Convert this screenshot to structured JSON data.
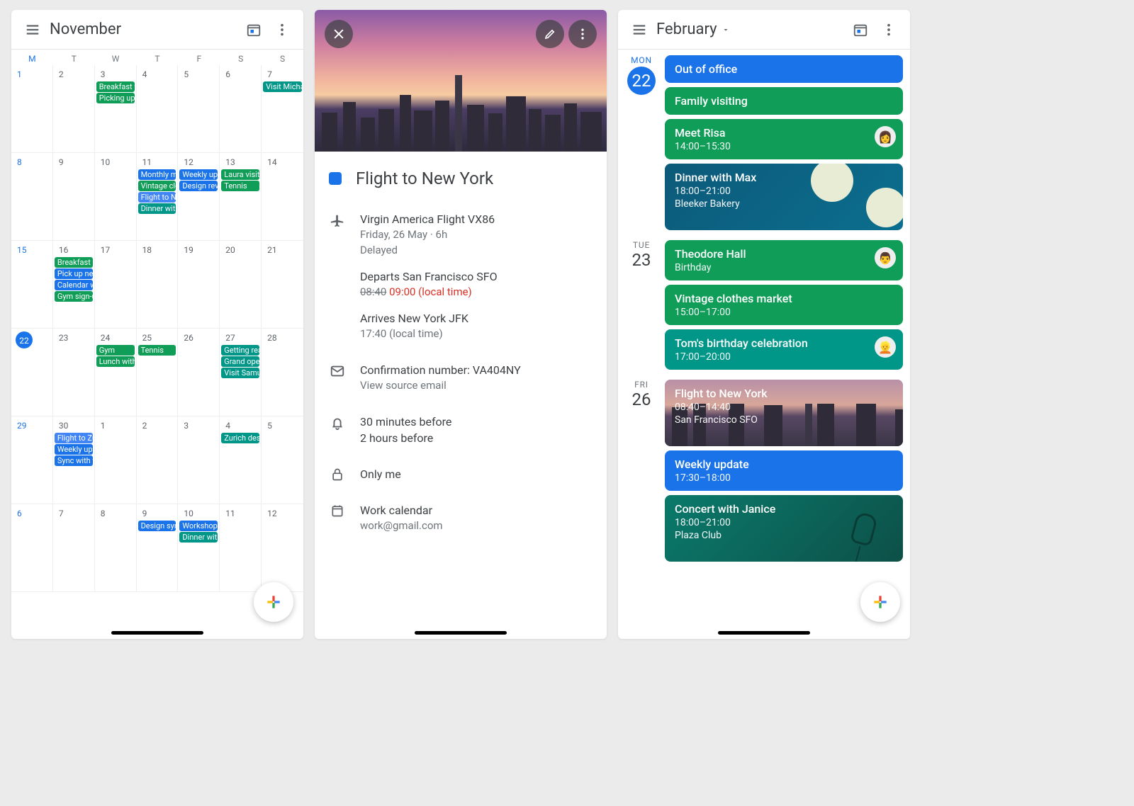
{
  "screen1": {
    "title": "November",
    "dow": [
      "M",
      "T",
      "W",
      "T",
      "F",
      "S",
      "S"
    ],
    "weeks": [
      [
        {
          "n": "1"
        },
        {
          "n": "2"
        },
        {
          "n": "3",
          "e": [
            {
              "t": "Breakfast w",
              "c": "green"
            },
            {
              "t": "Picking up",
              "c": "green"
            }
          ]
        },
        {
          "n": "4"
        },
        {
          "n": "5"
        },
        {
          "n": "6"
        },
        {
          "n": "7",
          "e": [
            {
              "t": "Visit Michae",
              "c": "teal"
            }
          ]
        }
      ],
      [
        {
          "n": "8"
        },
        {
          "n": "9"
        },
        {
          "n": "10"
        },
        {
          "n": "11",
          "e": [
            {
              "t": "Monthly me",
              "c": "blue"
            },
            {
              "t": "Vintage clo",
              "c": "green"
            },
            {
              "t": "Flight to Ne",
              "c": "blue2"
            },
            {
              "t": "Dinner with",
              "c": "teal"
            }
          ]
        },
        {
          "n": "12",
          "e": [
            {
              "t": "Weekly upd",
              "c": "blue"
            },
            {
              "t": "Design revi",
              "c": "blue"
            }
          ]
        },
        {
          "n": "13",
          "e": [
            {
              "t": "Laura visitin",
              "c": "green"
            },
            {
              "t": "Tennis",
              "c": "green"
            }
          ]
        },
        {
          "n": "14"
        }
      ],
      [
        {
          "n": "15"
        },
        {
          "n": "16",
          "e": [
            {
              "t": "Breakfast w",
              "c": "green"
            },
            {
              "t": "Pick up new",
              "c": "blue"
            },
            {
              "t": "Calendar w",
              "c": "blue"
            },
            {
              "t": "Gym sign-u",
              "c": "green"
            }
          ]
        },
        {
          "n": "17"
        },
        {
          "n": "18"
        },
        {
          "n": "19"
        },
        {
          "n": "20"
        },
        {
          "n": "21"
        }
      ],
      [
        {
          "n": "22",
          "today": true
        },
        {
          "n": "23"
        },
        {
          "n": "24",
          "e": [
            {
              "t": "Gym",
              "c": "green"
            },
            {
              "t": "Lunch with",
              "c": "green"
            }
          ]
        },
        {
          "n": "25",
          "e": [
            {
              "t": "Tennis",
              "c": "green"
            }
          ]
        },
        {
          "n": "26"
        },
        {
          "n": "27",
          "e": [
            {
              "t": "Getting rea",
              "c": "teal"
            },
            {
              "t": "Grand open",
              "c": "teal"
            },
            {
              "t": "Visit Samue",
              "c": "teal"
            }
          ]
        },
        {
          "n": "28"
        }
      ],
      [
        {
          "n": "29"
        },
        {
          "n": "30",
          "e": [
            {
              "t": "Flight to Zu",
              "c": "blue2"
            },
            {
              "t": "Weekly upd",
              "c": "blue"
            },
            {
              "t": "Sync with t",
              "c": "blue"
            }
          ]
        },
        {
          "n": "1"
        },
        {
          "n": "2"
        },
        {
          "n": "3"
        },
        {
          "n": "4",
          "e": [
            {
              "t": "Zurich desi",
              "c": "teal"
            }
          ]
        },
        {
          "n": "5"
        }
      ],
      [
        {
          "n": "6"
        },
        {
          "n": "7"
        },
        {
          "n": "8"
        },
        {
          "n": "9",
          "e": [
            {
              "t": "Design syn",
              "c": "blue"
            }
          ]
        },
        {
          "n": "10",
          "e": [
            {
              "t": "Workshop",
              "c": "blue"
            },
            {
              "t": "Dinner with",
              "c": "teal"
            }
          ]
        },
        {
          "n": "11"
        },
        {
          "n": "12"
        }
      ]
    ]
  },
  "screen2": {
    "title": "Flight to New York",
    "flight_line": "Virgin America Flight VX86",
    "date_line": "Friday, 26 May  ·  6h",
    "status": "Delayed",
    "dep_label": "Departs San Francisco SFO",
    "dep_old": "08:40",
    "dep_new": "09:00 (local time)",
    "arr_label": "Arrives New York JFK",
    "arr_time": "17:40 (local time)",
    "conf_label": "Confirmation number: VA404NY",
    "conf_link": "View source email",
    "rem1": "30 minutes before",
    "rem2": "2 hours before",
    "vis": "Only me",
    "cal_name": "Work calendar",
    "cal_email": "work@gmail.com"
  },
  "screen3": {
    "title": "February",
    "days": [
      {
        "dow": "MON",
        "num": "22",
        "today": true,
        "cards": [
          {
            "style": "c-blue",
            "title": "Out of office"
          },
          {
            "style": "c-green",
            "title": "Family visiting"
          },
          {
            "style": "c-green",
            "title": "Meet Risa",
            "sub": "14:00–15:30",
            "avatar": "👩",
            "now": true
          },
          {
            "style": "c-dinner",
            "title": "Dinner with Max",
            "sub": "18:00–21:00",
            "sub2": "Bleeker Bakery",
            "deco": "dinner"
          }
        ]
      },
      {
        "dow": "TUE",
        "num": "23",
        "cards": [
          {
            "style": "c-green",
            "title": "Theodore Hall",
            "sub": "Birthday",
            "avatar": "👨"
          },
          {
            "style": "c-green",
            "title": "Vintage clothes market",
            "sub": "15:00–17:00"
          },
          {
            "style": "c-teal",
            "title": "Tom's birthday celebration",
            "sub": "17:00–20:00",
            "avatar": "👱"
          }
        ]
      },
      {
        "dow": "FRI",
        "num": "26",
        "cards": [
          {
            "style": "c-flight",
            "title": "Flight to New York",
            "sub": "08:40–14:40",
            "sub2": "San Francisco SFO",
            "deco": "flight"
          },
          {
            "style": "c-blue",
            "title": "Weekly update",
            "sub": "17:30–18:00"
          },
          {
            "style": "c-concert",
            "title": "Concert with Janice",
            "sub": "18:00–21:00",
            "sub2": "Plaza Club",
            "deco": "concert"
          }
        ]
      }
    ]
  }
}
